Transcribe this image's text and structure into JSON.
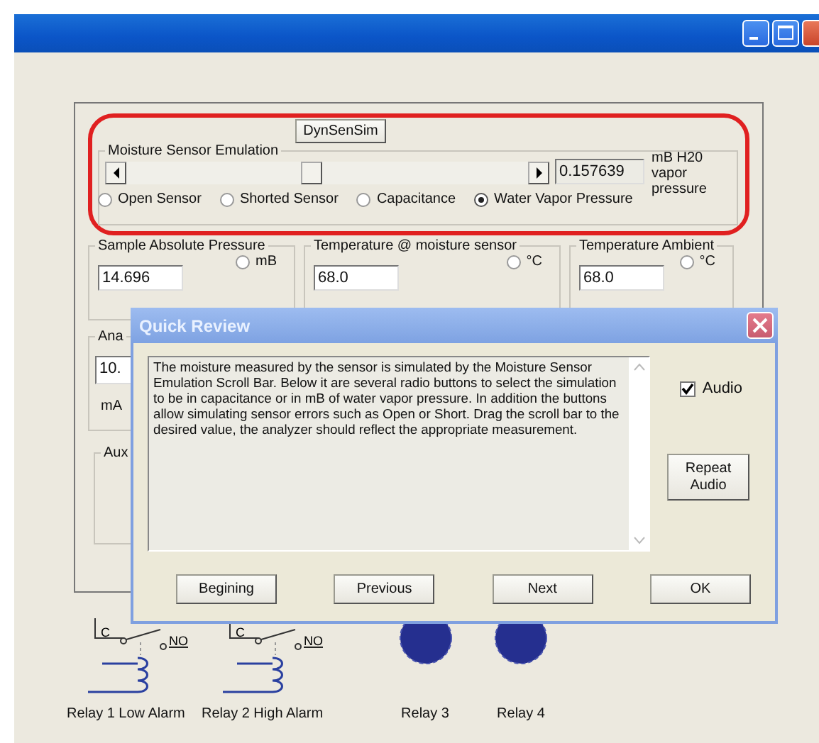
{
  "sim_button": "DynSenSim",
  "moisture": {
    "title": "Moisture Sensor Emulation",
    "value": "0.157639",
    "units": "mB H20 vapor pressure",
    "options": [
      {
        "label": "Open Sensor",
        "selected": false
      },
      {
        "label": "Shorted Sensor",
        "selected": false
      },
      {
        "label": "Capacitance",
        "selected": false
      },
      {
        "label": "Water Vapor Pressure",
        "selected": true
      }
    ]
  },
  "groups": [
    {
      "title": "Sample Absolute Pressure",
      "value": "14.696",
      "unit": "mB",
      "selected": false
    },
    {
      "title": "Temperature @ moisture sensor",
      "value": "68.0",
      "unit": "°C",
      "selected": false
    },
    {
      "title": "Temperature Ambient",
      "value": "68.0",
      "unit": "°C",
      "selected": false
    }
  ],
  "analog": {
    "title": "Ana",
    "value": "10.",
    "unit": "mA"
  },
  "aux": {
    "title": "Aux"
  },
  "dialog": {
    "title": "Quick Review",
    "text": "The moisture measured by the sensor is simulated by the Moisture Sensor Emulation Scroll Bar. Below it are several radio buttons to select the simulation to be in capacitance or in mB of water vapor pressure. In addition the buttons allow simulating sensor errors such as Open or Short. Drag the scroll bar to the desired value, the analyzer should reflect the appropriate measurement.",
    "audio": {
      "label": "Audio",
      "checked": true
    },
    "repeat": "Repeat Audio",
    "buttons": [
      "Begining",
      "Previous",
      "Next",
      "OK"
    ]
  },
  "relays": [
    {
      "kind": "coil",
      "label": "Relay 1 Low Alarm",
      "common": "C",
      "open": "NO"
    },
    {
      "kind": "coil",
      "label": "Relay 2 High Alarm",
      "common": "C",
      "open": "NO"
    },
    {
      "kind": "lamp",
      "label": "Relay 3"
    },
    {
      "kind": "lamp",
      "label": "Relay 4"
    }
  ]
}
